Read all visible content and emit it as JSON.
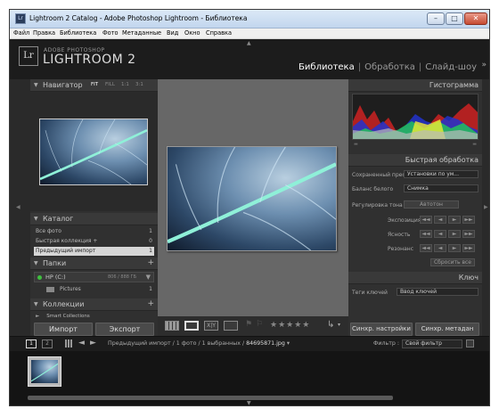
{
  "window": {
    "title": "Lightroom 2 Catalog - Adobe Photoshop Lightroom - Библиотека",
    "icon": "Lr",
    "minimize": "–",
    "maximize": "□",
    "close": "✕"
  },
  "menu": [
    "Файл",
    "Правка",
    "Библиотека",
    "Фото",
    "Метаданные",
    "Вид",
    "Окно",
    "Справка"
  ],
  "identity": {
    "logo": "Lr",
    "brand_small": "ADOBE PHOTOSHOP",
    "brand_large": "LIGHTROOM 2",
    "modules": [
      {
        "label": "Библиотека",
        "active": true
      },
      {
        "label": "Обработка",
        "active": false
      },
      {
        "label": "Слайд-шоу",
        "active": false
      }
    ],
    "more": "»"
  },
  "left": {
    "navigator": {
      "title": "Навигатор",
      "zoom": [
        "FIT",
        "FILL",
        "1:1",
        "3:1"
      ]
    },
    "catalog": {
      "title": "Каталог",
      "rows": [
        {
          "label": "Все фото",
          "count": "1"
        },
        {
          "label": "Быстрая коллекция +",
          "count": "0"
        },
        {
          "label": "Предыдущий импорт",
          "count": "1"
        }
      ]
    },
    "folders": {
      "title": "Папки",
      "drive": "HP (C:)",
      "drive_info": "806 / 888 ГБ",
      "items": [
        {
          "label": "Pictures",
          "count": "1"
        }
      ]
    },
    "collections": {
      "title": "Коллекции",
      "items": [
        {
          "label": "Smart Collections"
        }
      ]
    },
    "import_button": "Импорт",
    "export_button": "Экспорт"
  },
  "right": {
    "histogram": {
      "title": "Гистограмма"
    },
    "quick": {
      "title": "Быстрая обработка",
      "preset_label": "Сохраненный пресет",
      "preset_value": "Установки по ум...",
      "wb_label": "Баланс белого",
      "wb_value": "Снимка",
      "tone_label": "Регулировка тона",
      "auto_tone": "Автотон",
      "exposure": "Экспозиция",
      "clarity": "Ясность",
      "vibrance": "Резонанс",
      "reset": "Сбросить все"
    },
    "keywords": {
      "title": "Ключ",
      "tags_label": "Теги ключей",
      "tags_value": "Ввод ключей"
    },
    "sync_settings": "Синхр. настройки",
    "sync_meta": "Синхр. метадан"
  },
  "toolbar": {
    "stars": "★★★★★"
  },
  "filmbar": {
    "page1": "1",
    "page2": "2",
    "path": "Предыдущий импорт / 1 фото / 1 выбранных / ",
    "filename": "84695871.jpg",
    "dropdown": "▾",
    "filter_label": "Фильтр :",
    "filter_value": "Свой фильтр"
  },
  "colors": {
    "accent": "#ffffff",
    "panel": "#303030",
    "center_bg": "#676767",
    "selected_row": "#d6d6d6"
  }
}
